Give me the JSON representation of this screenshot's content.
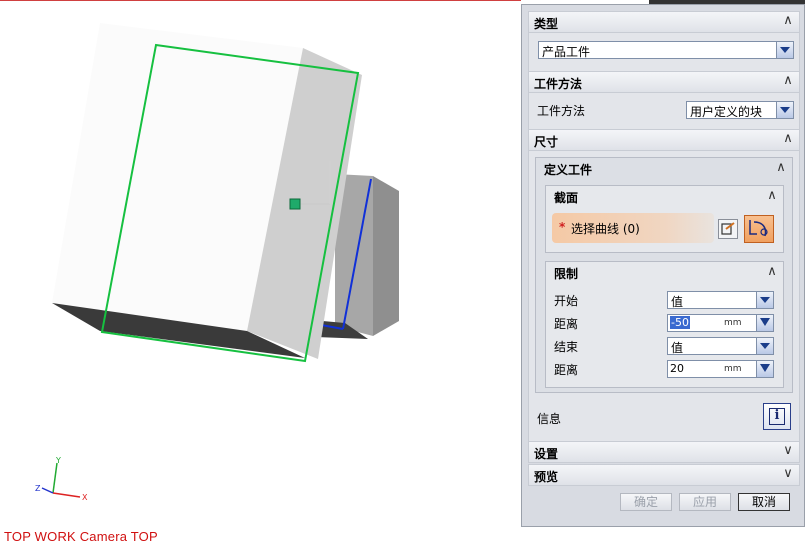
{
  "viewport": {
    "view_label": "TOP WORK Camera TOP",
    "axes": {
      "z": "Z",
      "x": "X",
      "y": "Y"
    }
  },
  "dialog": {
    "type_section": {
      "title": "类型",
      "selected": "产品工件"
    },
    "method_section": {
      "title": "工件方法",
      "field_label": "工件方法",
      "selected": "用户定义的块"
    },
    "size_section": {
      "title": "尺寸",
      "define_group": {
        "title": "定义工件",
        "section_group": {
          "title": "截面",
          "select_curve_label": "选择曲线 (0)",
          "required_marker": "*"
        },
        "limit_group": {
          "title": "限制",
          "start_label": "开始",
          "start_value": "值",
          "distance1_label": "距离",
          "distance1_value": "-50",
          "end_label": "结束",
          "end_value": "值",
          "distance2_label": "距离",
          "distance2_value": "20",
          "unit": "mm"
        }
      },
      "info_label": "信息"
    },
    "settings_section": {
      "title": "设置"
    },
    "preview_section": {
      "title": "预览"
    },
    "buttons": {
      "ok": "确定",
      "apply": "应用",
      "cancel": "取消"
    }
  },
  "colors": {
    "accent": "#1a3d8a",
    "highlight": "#f0b080",
    "view_label": "#d01010"
  }
}
